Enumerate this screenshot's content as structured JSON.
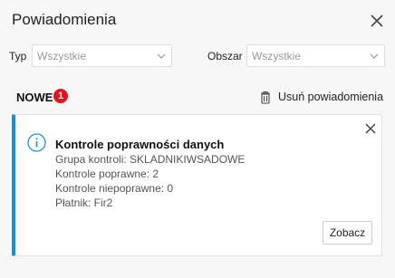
{
  "header": {
    "title": "Powiadomienia",
    "close_icon": "close-icon"
  },
  "filters": {
    "type": {
      "label": "Typ",
      "value": "Wszystkie",
      "icon": "chevron-down-icon"
    },
    "area": {
      "label": "Obszar",
      "value": "Wszystkie",
      "icon": "chevron-down-icon"
    }
  },
  "section": {
    "title": "NOWE",
    "count": "1",
    "remove_all_label": "Usuń powiadomienia",
    "remove_icon": "trash-icon"
  },
  "notification": {
    "icon": "info-icon",
    "title": "Kontrole poprawności danych",
    "lines": [
      "Grupa kontroli: SKLADNIKIWSADOWE",
      "Kontrole poprawne: 2",
      "Kontrole niepoprawne: 0",
      "Płatnik: Fir2"
    ],
    "view_label": "Zobacz",
    "accent_color": "#1c8fd3"
  },
  "colors": {
    "badge": "#e0141e",
    "background": "#f7f7f7"
  }
}
